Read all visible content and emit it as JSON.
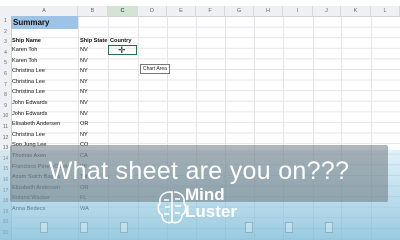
{
  "columns": [
    "A",
    "B",
    "C",
    "D",
    "E",
    "F",
    "G",
    "H",
    "I",
    "J",
    "K",
    "L"
  ],
  "selected_column": "C",
  "rows": [
    "1",
    "2",
    "3",
    "4",
    "5",
    "6",
    "7",
    "8",
    "9",
    "10",
    "11",
    "12",
    "13",
    "14",
    "15",
    "16",
    "17",
    "18",
    "19",
    "20",
    "21"
  ],
  "title": "Summary",
  "headers": {
    "ship_name": "Ship Name",
    "ship_state": "Ship State",
    "country": "Country"
  },
  "records": [
    {
      "name": "Karen Toh",
      "state": "NV"
    },
    {
      "name": "Karen Toh",
      "state": "NV"
    },
    {
      "name": "Christina Lee",
      "state": "NY"
    },
    {
      "name": "Christina Lee",
      "state": "NY"
    },
    {
      "name": "Christina Lee",
      "state": "NY"
    },
    {
      "name": "John Edwards",
      "state": "NV"
    },
    {
      "name": "John Edwards",
      "state": "NV"
    },
    {
      "name": "Elisabeth Andersen",
      "state": "OR"
    },
    {
      "name": "Christina Lee",
      "state": "NY"
    },
    {
      "name": "Soo Jung Lee",
      "state": "CO"
    },
    {
      "name": "Thomas Axen",
      "state": "CA"
    },
    {
      "name": "Francisco Pérez-Olaeta",
      "state": "WI"
    },
    {
      "name": "Azam Sutch Bagha",
      "state": "TN"
    },
    {
      "name": "Elizabeth Andersen",
      "state": "OR"
    },
    {
      "name": "Roland Wacker",
      "state": "FL"
    },
    {
      "name": "Anna Bedecs",
      "state": "WA"
    }
  ],
  "tooltip": "Chart Area",
  "caption": "What sheet are you on???",
  "logo": {
    "line1": "Mind",
    "line2": "Luster"
  },
  "colors": {
    "summary_fill": "#9dc3e6",
    "selection": "#217346",
    "caption_text": "#ffffff"
  }
}
